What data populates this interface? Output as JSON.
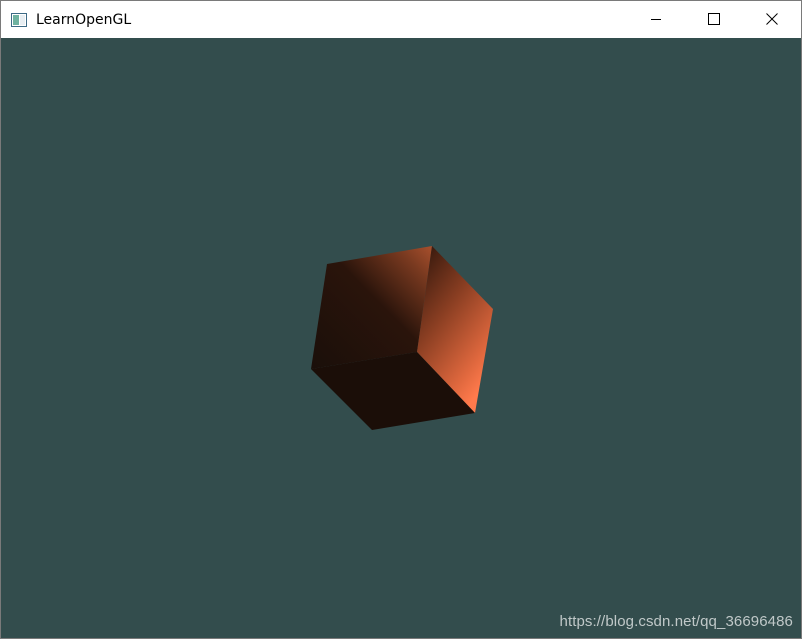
{
  "window": {
    "title": "LearnOpenGL",
    "icon": "window-app-icon",
    "controls": {
      "minimize_icon": "minimize-icon",
      "maximize_icon": "maximize-icon",
      "close_icon": "close-icon"
    }
  },
  "scene": {
    "clear_color": "#334d4d",
    "object": "lit-cube",
    "object_color": "#ff7f50"
  },
  "watermark": {
    "text": "https://blog.csdn.net/qq_36696486"
  }
}
